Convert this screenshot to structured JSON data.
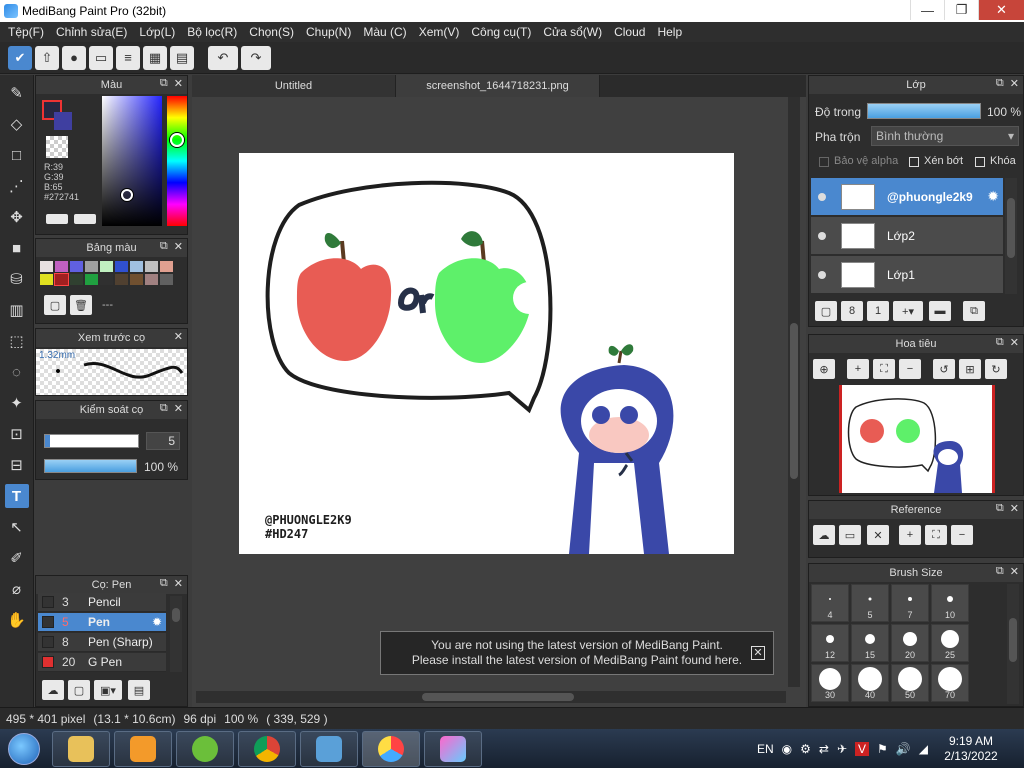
{
  "window": {
    "title": "MediBang Paint Pro (32bit)",
    "min": "—",
    "max": "❐",
    "close": "✕"
  },
  "menu": [
    "Tệp(F)",
    "Chỉnh sửa(E)",
    "Lớp(L)",
    "Bộ lọc(R)",
    "Chọn(S)",
    "Chụp(N)",
    "Màu (C)",
    "Xem(V)",
    "Công cụ(T)",
    "Cửa sổ(W)",
    "Cloud",
    "Help"
  ],
  "toolbar": {
    "undo": "↶",
    "redo": "↷"
  },
  "tabs": [
    "Untitled",
    "screenshot_1644718231.png"
  ],
  "color_panel": {
    "title": "Màu",
    "r": "R:39",
    "g": "G:39",
    "b": "B:65",
    "hex": "#272741"
  },
  "palette_panel": {
    "title": "Bảng màu",
    "dashes": "---",
    "colors": [
      "#e8e0e0",
      "#c060c0",
      "#6060e0",
      "#a0a0a0",
      "#c0f0c0",
      "#3050d0",
      "#a0c0e0",
      "#c0c0c0",
      "#e0a090",
      "#e0e020",
      "#a02020",
      "#304030",
      "#20a040",
      "#303030",
      "#504030",
      "#705030",
      "#a08080",
      "#606060"
    ]
  },
  "preview_panel": {
    "title": "Xem trước cọ",
    "size": "1.32mm"
  },
  "brush_control": {
    "title": "Kiểm soát cọ",
    "size_value": "5",
    "opacity_value": "100 %",
    "size_level": 0.05,
    "opacity_level": 1.0
  },
  "brush_list": {
    "title": "Cọ: Pen",
    "items": [
      {
        "num": "3",
        "name": "Pencil",
        "color": "#333333"
      },
      {
        "num": "5",
        "name": "Pen",
        "color": "#333333"
      },
      {
        "num": "8",
        "name": "Pen (Sharp)",
        "color": "#333333"
      },
      {
        "num": "20",
        "name": "G Pen",
        "color": "#e03030"
      }
    ]
  },
  "layer_panel": {
    "title": "Lớp",
    "opacity_label": "Độ trong",
    "opacity_value": "100 %",
    "opacity_level": 1.0,
    "blend_label": "Pha trộn",
    "blend_value": "Bình thường",
    "protect_alpha": "Bảo vệ alpha",
    "clipping": "Xén bớt",
    "lock": "Khóa",
    "layers": [
      {
        "name": "@phuongle2k9"
      },
      {
        "name": "Lớp2"
      },
      {
        "name": "Lớp1"
      }
    ]
  },
  "navigator_panel": {
    "title": "Hoa tiêu"
  },
  "reference_panel": {
    "title": "Reference"
  },
  "brush_size_panel": {
    "title": "Brush Size",
    "sizes": [
      "4",
      "5",
      "7",
      "10",
      "12",
      "15",
      "20",
      "25",
      "30",
      "40",
      "50",
      "70"
    ]
  },
  "canvas": {
    "watermark_line1": "@PHUONGLE2K9",
    "watermark_line2": "#HD247",
    "or_text": "or"
  },
  "notice": {
    "line1": "You are not using the latest version of MediBang Paint.",
    "line2": "Please install the latest version of MediBang Paint found here."
  },
  "status": {
    "size": "495 * 401 pixel",
    "cm": "(13.1 * 10.6cm)",
    "dpi": "96 dpi",
    "zoom": "100 %",
    "coords": "( 339, 529 )"
  },
  "taskbar": {
    "lang": "EN",
    "time": "9:19 AM",
    "date": "2/13/2022"
  }
}
